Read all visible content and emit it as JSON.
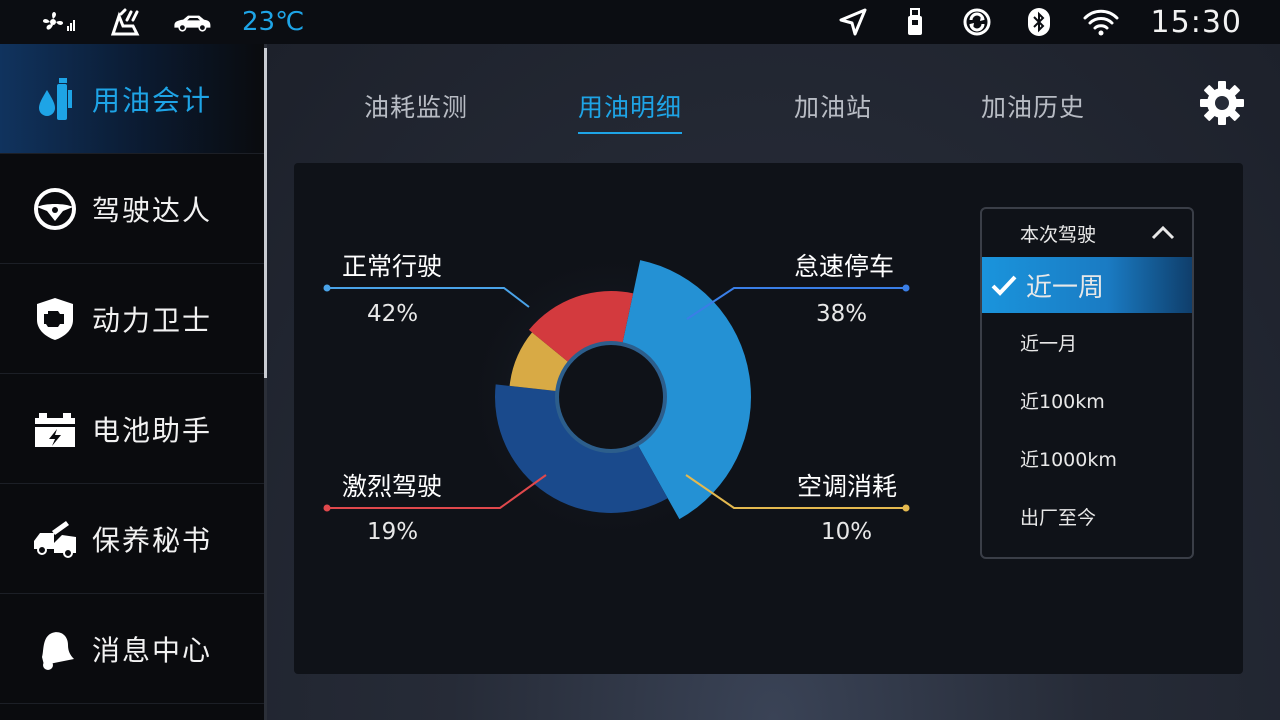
{
  "statusbar": {
    "temperature": "23℃",
    "time": "15:30",
    "left_icons": [
      "fan-icon",
      "seat-heat-icon",
      "car-icon"
    ],
    "right_icons": [
      "navigation-icon",
      "usb-icon",
      "sync-icon",
      "bluetooth-icon",
      "wifi-icon"
    ]
  },
  "sidebar": {
    "items": [
      {
        "label": "用油会计",
        "icon": "fuel-drop-icon",
        "active": true
      },
      {
        "label": "驾驶达人",
        "icon": "steering-wheel-icon",
        "active": false
      },
      {
        "label": "动力卫士",
        "icon": "engine-shield-icon",
        "active": false
      },
      {
        "label": "电池助手",
        "icon": "battery-icon",
        "active": false
      },
      {
        "label": "保养秘书",
        "icon": "car-service-icon",
        "active": false
      },
      {
        "label": "消息中心",
        "icon": "bell-icon",
        "active": false
      }
    ]
  },
  "tabs": [
    {
      "label": "油耗监测",
      "active": false
    },
    {
      "label": "用油明细",
      "active": true
    },
    {
      "label": "加油站",
      "active": false
    },
    {
      "label": "加油历史",
      "active": false
    }
  ],
  "colors": {
    "accent": "#1ea4e6",
    "normal": "#2491d4",
    "idle": "#1a4a8c",
    "aggressive": "#d33a3e",
    "ac": "#d8aa45"
  },
  "dropdown": {
    "header": "本次驾驶",
    "options": [
      "近一周",
      "近一月",
      "近100km",
      "近1000km",
      "出厂至今"
    ],
    "selected": "近一周"
  },
  "chart_data": {
    "type": "pie",
    "slices": [
      {
        "label": "正常行驶",
        "value": 42,
        "display": "42%",
        "color": "#2491d4"
      },
      {
        "label": "怠速停车",
        "value": 38,
        "display": "38%",
        "color": "#1a4a8c"
      },
      {
        "label": "空调消耗",
        "value": 10,
        "display": "10%",
        "color": "#d8aa45"
      },
      {
        "label": "激烈驾驶",
        "value": 19,
        "display": "19%",
        "color": "#d33a3e"
      }
    ]
  }
}
